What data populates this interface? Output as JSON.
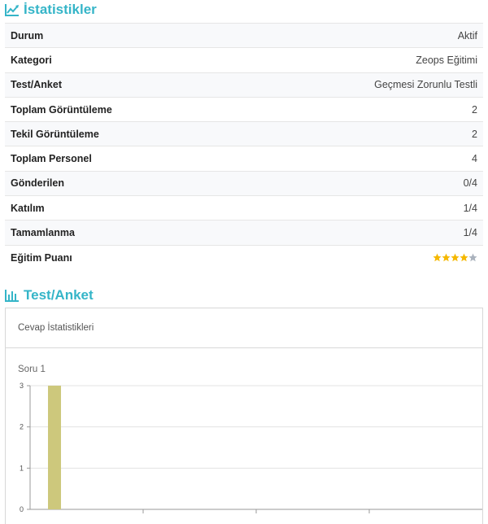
{
  "stats_section": {
    "title": "İstatistikler",
    "icon": "line-chart-icon",
    "rows": [
      {
        "label": "Durum",
        "value": "Aktif"
      },
      {
        "label": "Kategori",
        "value": "Zeops Eğitimi"
      },
      {
        "label": "Test/Anket",
        "value": "Geçmesi Zorunlu Testli"
      },
      {
        "label": "Toplam Görüntüleme",
        "value": "2"
      },
      {
        "label": "Tekil Görüntüleme",
        "value": "2"
      },
      {
        "label": "Toplam Personel",
        "value": "4"
      },
      {
        "label": "Gönderilen",
        "value": "0/4"
      },
      {
        "label": "Katılım",
        "value": "1/4"
      },
      {
        "label": "Tamamlanma",
        "value": "1/4"
      }
    ],
    "rating": {
      "label": "Eğitim Puanı",
      "stars": 4,
      "max": 5,
      "filled_color": "#f5b800",
      "empty_color": "#aab2bd"
    }
  },
  "test_section": {
    "title": "Test/Anket",
    "icon": "bar-chart-icon",
    "panel_header": "Cevap İstatistikleri"
  },
  "colors": {
    "accent": "#35b5c8",
    "bar": "#cdc87c"
  },
  "chart_data": {
    "type": "bar",
    "title": "Soru 1",
    "categories": [
      "",
      "",
      "",
      ""
    ],
    "values": [
      3
    ],
    "ylim": [
      0,
      3
    ],
    "yticks": [
      "0",
      "1",
      "2",
      "3"
    ],
    "grid": true
  }
}
